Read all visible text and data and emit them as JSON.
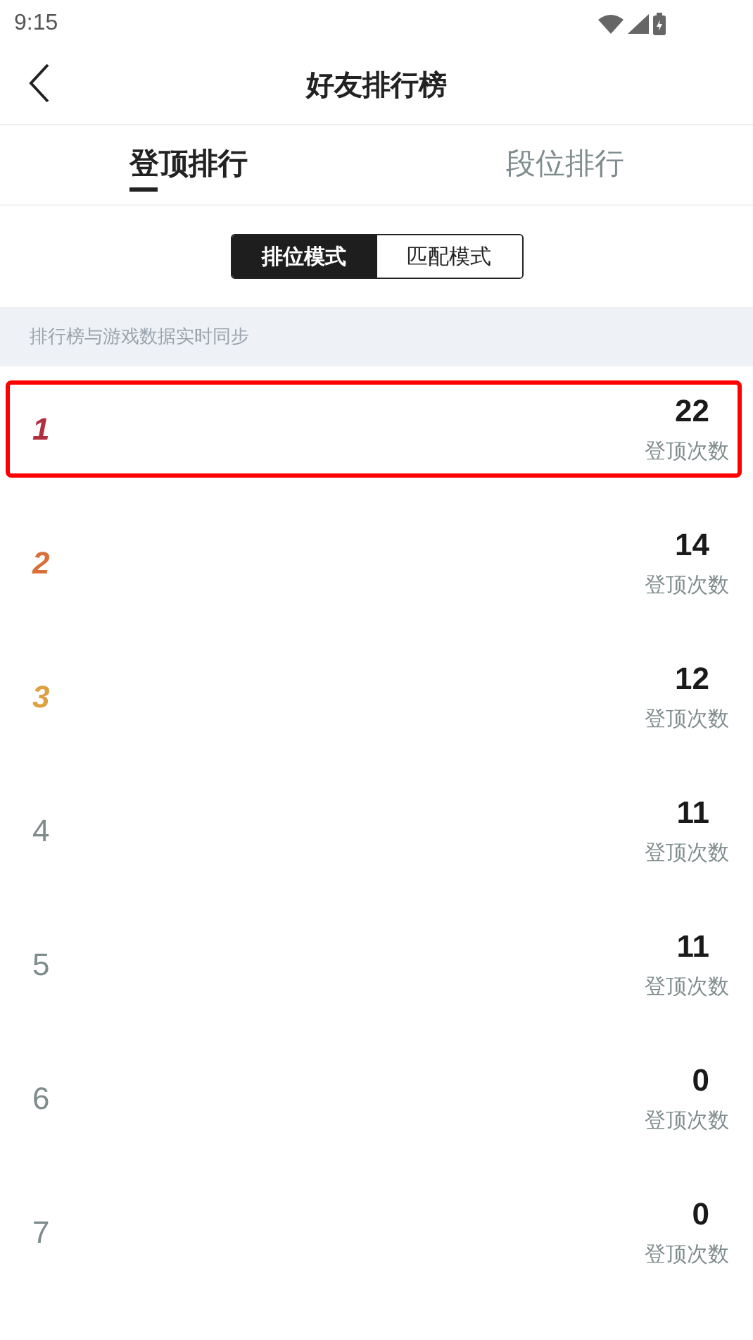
{
  "status_bar": {
    "time": "9:15"
  },
  "header": {
    "title": "好友排行榜"
  },
  "tabs": [
    {
      "label": "登顶排行",
      "selected": true
    },
    {
      "label": "段位排行",
      "selected": false
    }
  ],
  "modes": [
    {
      "label": "排位模式",
      "selected": true
    },
    {
      "label": "匹配模式",
      "selected": false
    }
  ],
  "notice": "排行榜与游戏数据实时同步",
  "rows": [
    {
      "rank": "1",
      "kind": "top",
      "color": "#b0303f",
      "highlighted": true,
      "count": "22",
      "count_label": "登顶次数"
    },
    {
      "rank": "2",
      "kind": "top",
      "color": "#d8703a",
      "highlighted": false,
      "count": "14",
      "count_label": "登顶次数"
    },
    {
      "rank": "3",
      "kind": "top",
      "color": "#dea040",
      "highlighted": false,
      "count": "12",
      "count_label": "登顶次数"
    },
    {
      "rank": "4",
      "kind": "plain",
      "highlighted": false,
      "count": "11",
      "count_label": "登顶次数"
    },
    {
      "rank": "5",
      "kind": "plain",
      "highlighted": false,
      "count": "11",
      "count_label": "登顶次数"
    },
    {
      "rank": "6",
      "kind": "plain",
      "highlighted": false,
      "count": "0",
      "count_label": "登顶次数"
    },
    {
      "rank": "7",
      "kind": "plain",
      "highlighted": false,
      "count": "0",
      "count_label": "登顶次数"
    }
  ]
}
